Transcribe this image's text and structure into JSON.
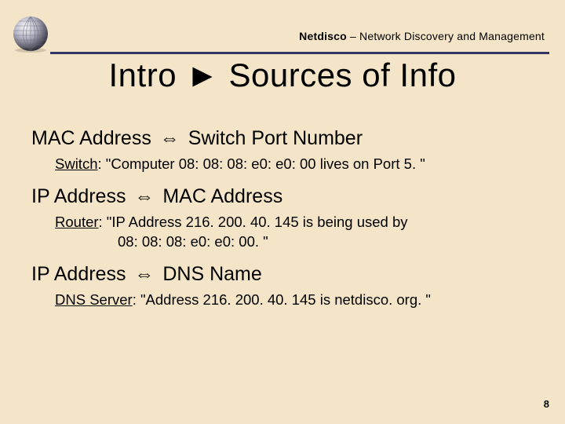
{
  "header": {
    "brand_bold": "Netdisco",
    "brand_rest": " – Network Discovery and Management"
  },
  "title": {
    "prefix": "Intro ",
    "arrow": "►",
    "rest": " Sources of Info"
  },
  "sections": [
    {
      "heading_left": "MAC Address",
      "heading_arrow": "⇔",
      "heading_right": "Switch Port Number",
      "label": "Switch",
      "quote_a": ": \"Computer 08: 08: 08: e0: e0: 00 lives on Port 5. \"",
      "quote_b": ""
    },
    {
      "heading_left": "IP Address",
      "heading_arrow": "⇔",
      "heading_right": "MAC Address",
      "label": "Router",
      "quote_a": ": \"IP Address 216. 200. 40. 145 is being used by",
      "quote_b": "08: 08: 08: e0: e0: 00. \""
    },
    {
      "heading_left": "IP Address",
      "heading_arrow": "⇔",
      "heading_right": "DNS Name",
      "label": "DNS Server",
      "quote_a": ": \"Address 216. 200. 40. 145 is netdisco. org. \"",
      "quote_b": ""
    }
  ],
  "page_number": "8"
}
